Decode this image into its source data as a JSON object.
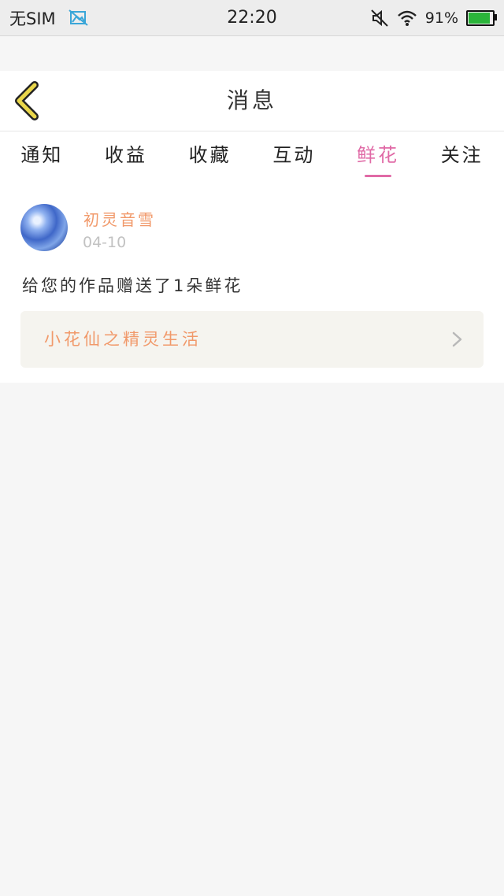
{
  "status_bar": {
    "carrier": "无SIM",
    "time": "22:20",
    "battery_percent": "91%",
    "battery_level": 0.91,
    "icons": [
      "image-icon",
      "mute-icon",
      "wifi-icon",
      "battery-icon"
    ],
    "battery_color": "#2bb43a"
  },
  "header": {
    "title": "消息",
    "back_icon": "chevron-left-icon",
    "back_icon_color": "#e9d64a"
  },
  "tabs": [
    {
      "label": "通知"
    },
    {
      "label": "收益"
    },
    {
      "label": "收藏"
    },
    {
      "label": "互动"
    },
    {
      "label": "鲜花",
      "active": true
    },
    {
      "label": "关注"
    }
  ],
  "accent_color": "#e06aa6",
  "message_item": {
    "avatar": "avatar-image",
    "user_name": "初灵音雪",
    "date": "04-10",
    "text": "给您的作品赠送了1朵鲜花",
    "link_title": "小花仙之精灵生活",
    "link_icon": "chevron-right-icon",
    "name_color": "#f1996a"
  }
}
